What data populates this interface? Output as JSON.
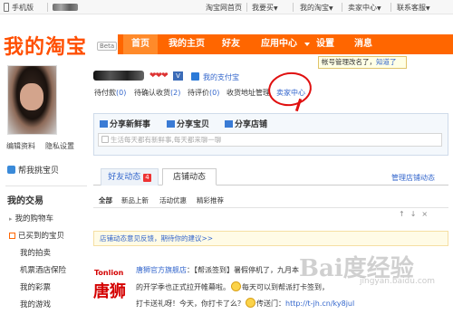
{
  "topbar": {
    "mobile": "手机版",
    "home": "淘宝网首页",
    "buy": "我要买",
    "my_taobao": "我的淘宝",
    "seller": "卖家中心",
    "contact": "联系客服"
  },
  "logo": {
    "text": "我的淘宝",
    "beta": "Beta"
  },
  "nav": [
    {
      "label": "首页",
      "active": true
    },
    {
      "label": "我的主页",
      "active": false
    },
    {
      "label": "好友",
      "active": false
    },
    {
      "label": "应用中心",
      "active": false
    },
    {
      "label": "设置",
      "active": false
    },
    {
      "label": "消息",
      "active": false
    }
  ],
  "tooltip": {
    "text": "帐号管理改名了，",
    "close": "知道了"
  },
  "profile": {
    "alipay": "我的支付宝",
    "edit": "编辑资料",
    "privacy": "隐私设置",
    "stats": {
      "pay": "待付款",
      "pay_n": "(0)",
      "recv": "待确认收货",
      "recv_n": "(2)",
      "rate": "待评价",
      "rate_n": "(0)",
      "address": "收货地址管理",
      "seller_center": "卖家中心"
    }
  },
  "share": {
    "new": "分享新鲜事",
    "item": "分享宝贝",
    "shop": "分享店铺",
    "placeholder": "生活每天都有新鲜事,每天都来聊一聊"
  },
  "sidebar": {
    "help": "帮我挑宝贝",
    "title": "我的交易",
    "items": [
      "我的购物车",
      "已买到的宝贝",
      "我的拍卖",
      "机票酒店保险",
      "我的彩票",
      "我的游戏"
    ]
  },
  "feed": {
    "tabs": [
      {
        "label": "好友动态",
        "badge": "4"
      },
      {
        "label": "店铺动态"
      }
    ],
    "manage": "管理店铺动态",
    "filters": [
      "全部",
      "新品上新",
      "活动优惠",
      "精彩推荐"
    ],
    "notice": "店铺动态意见反馈，期待你的建议>>",
    "brand_en": "Tonlion",
    "brand_cn": "唐狮",
    "post": {
      "shop": "唐狮官方旗舰店",
      "line1": "：【帮派签到】暑假停机了，九月本",
      "line2": "的开学季也正式拉开帷幕啦。",
      "line2b": "每天可以到帮派打卡签到，",
      "line3": "打卡送礼呀！今天，你打卡了么？",
      "line3b": "传送门：",
      "link": "http://t-jh.cn/ky8jul"
    }
  },
  "watermark": {
    "main": "Bai度经验",
    "sub": "jingyan.baidu.com"
  }
}
